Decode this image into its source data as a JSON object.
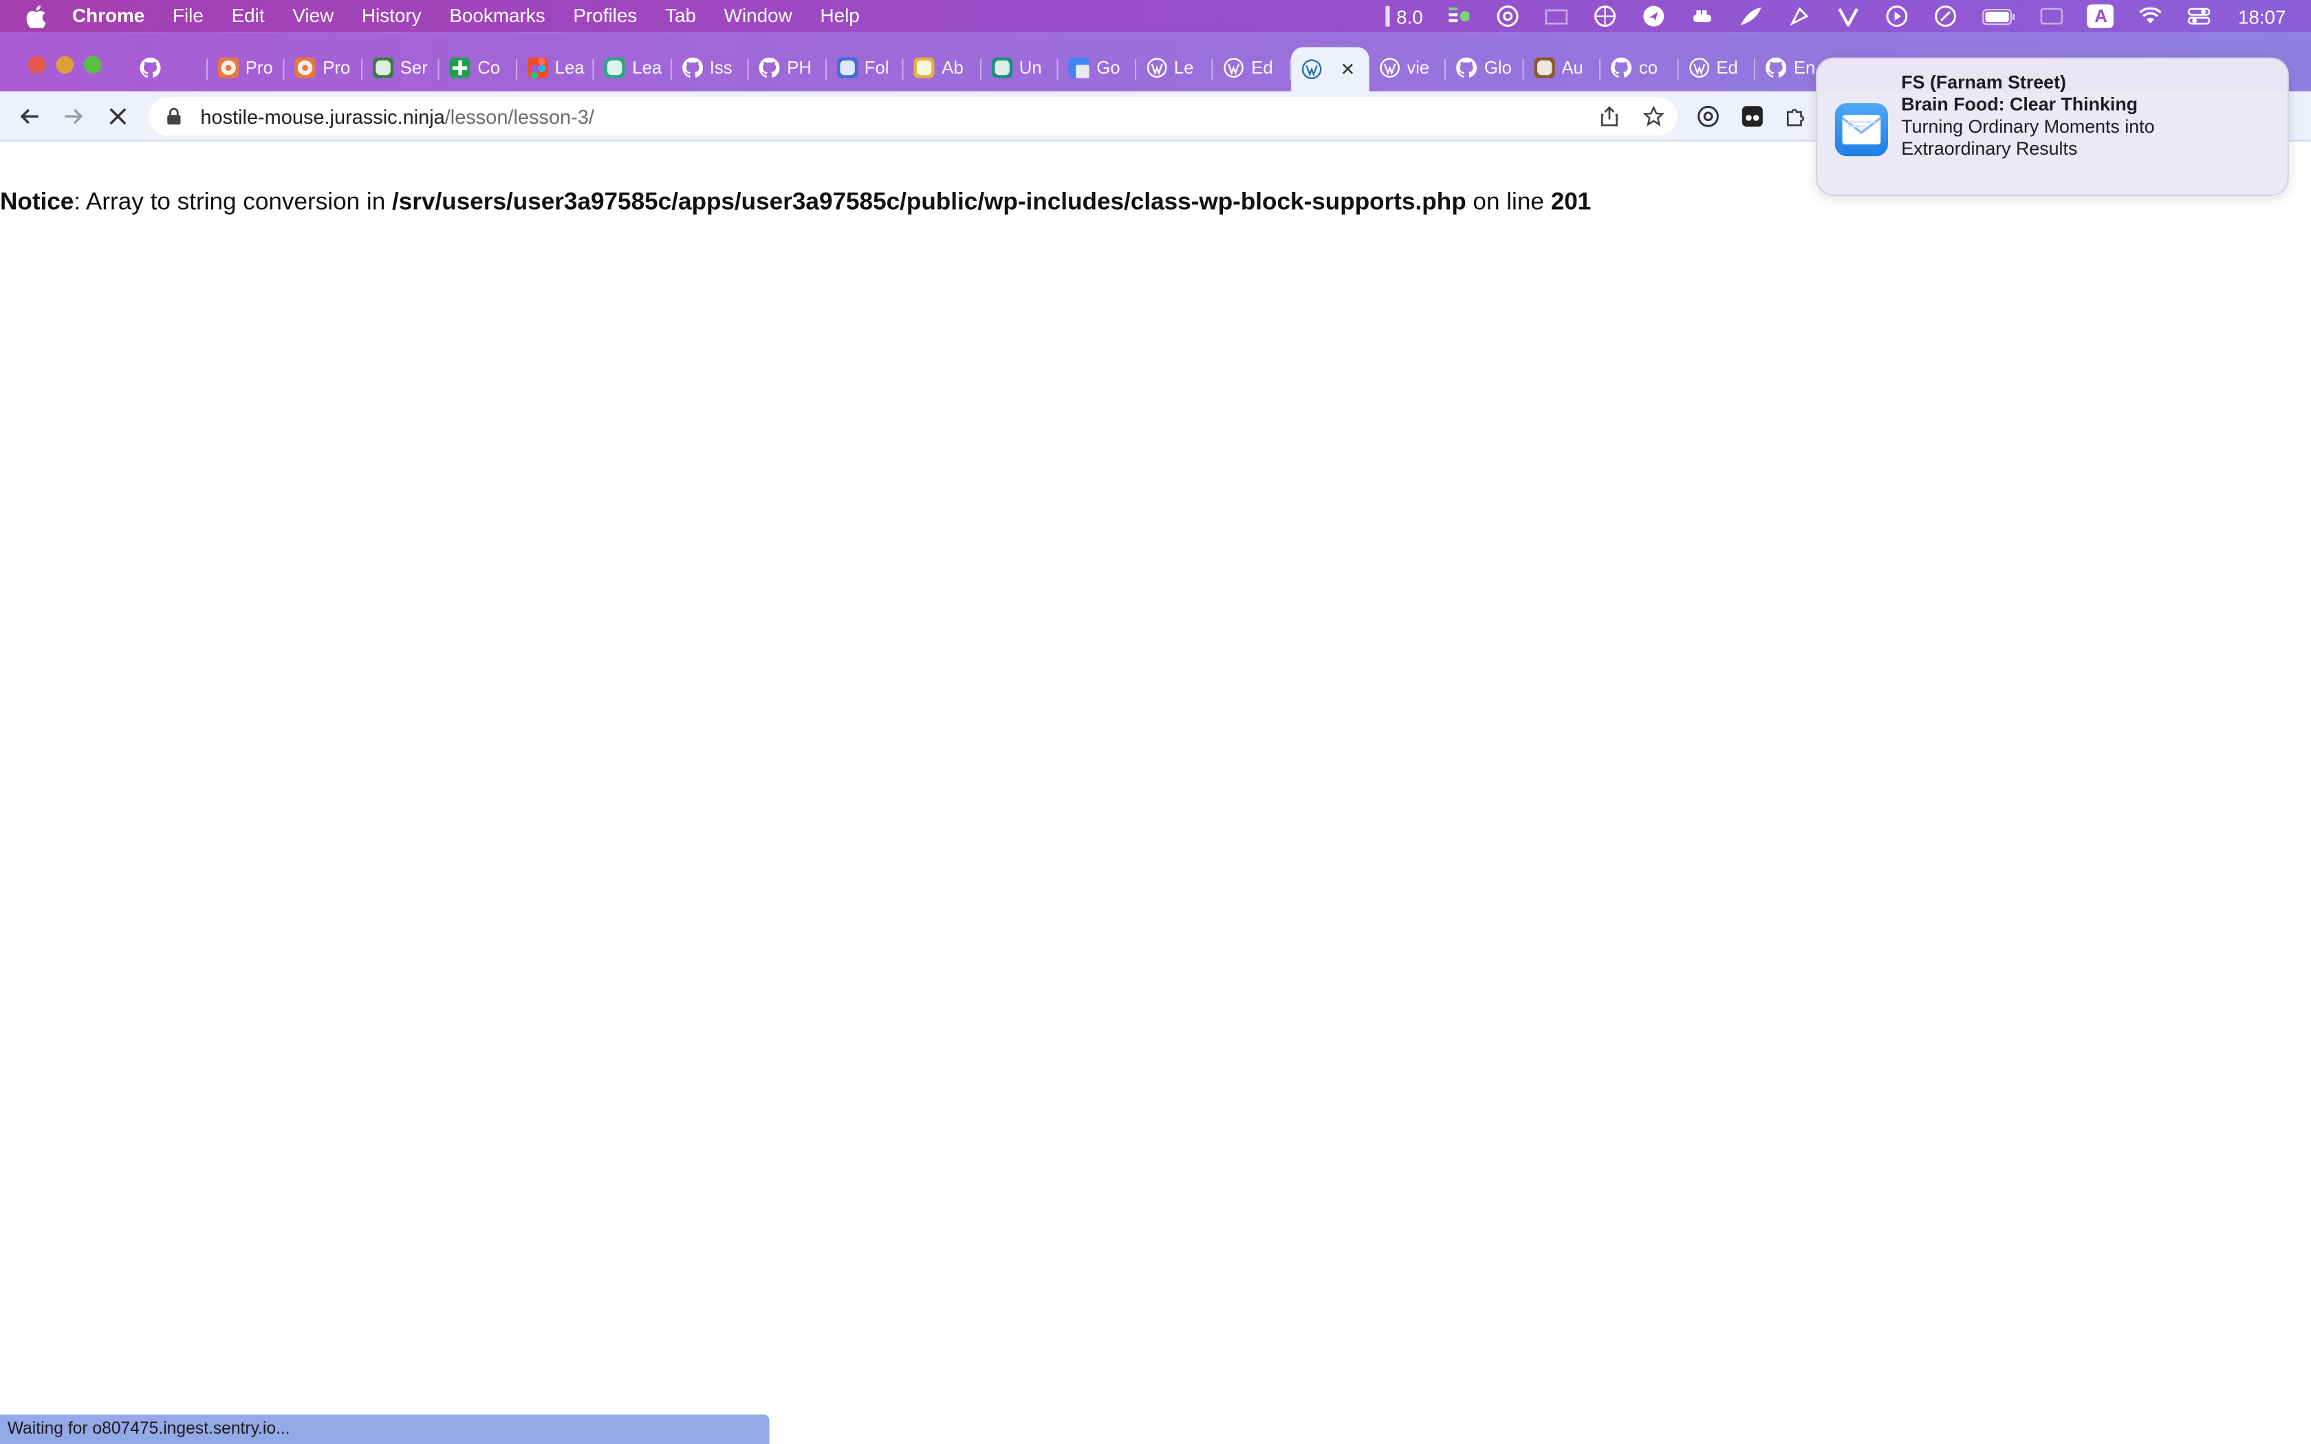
{
  "menubar": {
    "app_name": "Chrome",
    "menus": [
      "File",
      "Edit",
      "View",
      "History",
      "Bookmarks",
      "Profiles",
      "Tab",
      "Window",
      "Help"
    ],
    "status_text": "8.0",
    "input_indicator": "A",
    "clock": "18:07"
  },
  "tabs": [
    {
      "label": "",
      "icon": "github-icon",
      "color": "#24292e"
    },
    {
      "label": "Pro",
      "icon": "ph-icon",
      "color": "#e8773a"
    },
    {
      "label": "Pro",
      "icon": "ph-icon",
      "color": "#e8773a"
    },
    {
      "label": "Ser",
      "icon": "app-icon",
      "color": "#3a7d44"
    },
    {
      "label": "Co",
      "icon": "plus-icon",
      "color": "#1e9e4f"
    },
    {
      "label": "Lea",
      "icon": "figma-icon",
      "color": "#f24e1e"
    },
    {
      "label": "Lea",
      "icon": "app-icon",
      "color": "#2aa882"
    },
    {
      "label": "Iss",
      "icon": "github-icon",
      "color": "#24292e"
    },
    {
      "label": "PH",
      "icon": "github-icon",
      "color": "#24292e"
    },
    {
      "label": "Fol",
      "icon": "app-icon",
      "color": "#3b6fd6"
    },
    {
      "label": "Ab",
      "icon": "app-icon",
      "color": "#e6b23a"
    },
    {
      "label": "Un",
      "icon": "app-icon",
      "color": "#1f8f7a"
    },
    {
      "label": "Go",
      "icon": "translate-icon",
      "color": "#4285f4"
    },
    {
      "label": "Le",
      "icon": "wordpress-icon",
      "color": "#3c434a"
    },
    {
      "label": "Ed",
      "icon": "wordpress-icon",
      "color": "#3c434a"
    },
    {
      "label": "",
      "icon": "wordpress-icon",
      "color": "#2271b1",
      "active": true
    },
    {
      "label": "vie",
      "icon": "wordpress-icon",
      "color": "#3c434a"
    },
    {
      "label": "Glo",
      "icon": "github-icon",
      "color": "#24292e"
    },
    {
      "label": "Au",
      "icon": "app-icon",
      "color": "#8a5a2b"
    },
    {
      "label": "co",
      "icon": "github-icon",
      "color": "#24292e"
    },
    {
      "label": "Ed",
      "icon": "wordpress-icon",
      "color": "#3c434a"
    },
    {
      "label": "En",
      "icon": "github-icon",
      "color": "#24292e"
    }
  ],
  "address_bar": {
    "host": "hostile-mouse.jurassic.ninja",
    "path": "/lesson/lesson-3/"
  },
  "notice": {
    "label": "Notice",
    "message_before_path": ": Array to string conversion in ",
    "path": "/srv/users/user3a97585c/apps/user3a97585c/public/wp-includes/class-wp-block-supports.php",
    "message_before_line": " on line ",
    "line": "201"
  },
  "notification": {
    "sender": "FS (Farnam Street)",
    "subject": "Brain Food: Clear Thinking",
    "body_line1": "Turning Ordinary Moments into",
    "body_line2": "Extraordinary Results"
  },
  "status_bubble": "Waiting for o807475.ingest.sentry.io..."
}
